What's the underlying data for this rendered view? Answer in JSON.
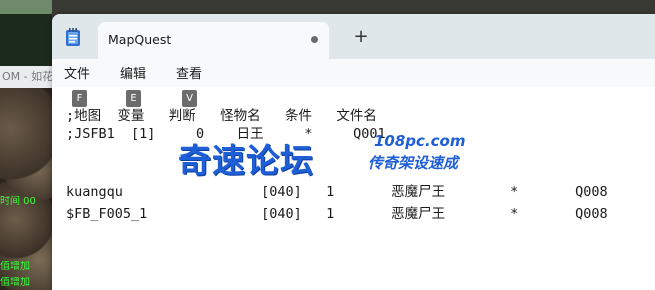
{
  "background": {
    "titlebar_fragment": "OM - 如花",
    "overlay_lines": [
      "时间 00",
      "值增加",
      "值增加"
    ]
  },
  "tab": {
    "title": "MapQuest",
    "new_tab_label": "+"
  },
  "menu": [
    {
      "label": "文件",
      "key": "F"
    },
    {
      "label": "编辑",
      "key": "E"
    },
    {
      "label": "查看",
      "key": "V"
    }
  ],
  "lines": [
    ";地图  变量   判断   怪物名   条件   文件名",
    ";JSFB1  [1]     0    日王     *     Q001",
    "",
    "",
    "kuangqu                 [040]   1       恶魔尸王        *       Q008",
    "$FB_F005_1              [040]   1       恶魔尸王        *       Q008"
  ],
  "watermark": {
    "main": "奇速论坛",
    "url": "108pc.com",
    "sub": "传奇架设速成"
  },
  "colors": {
    "accent": "#1e5ed6",
    "tabbar": "#dfe7ea"
  }
}
